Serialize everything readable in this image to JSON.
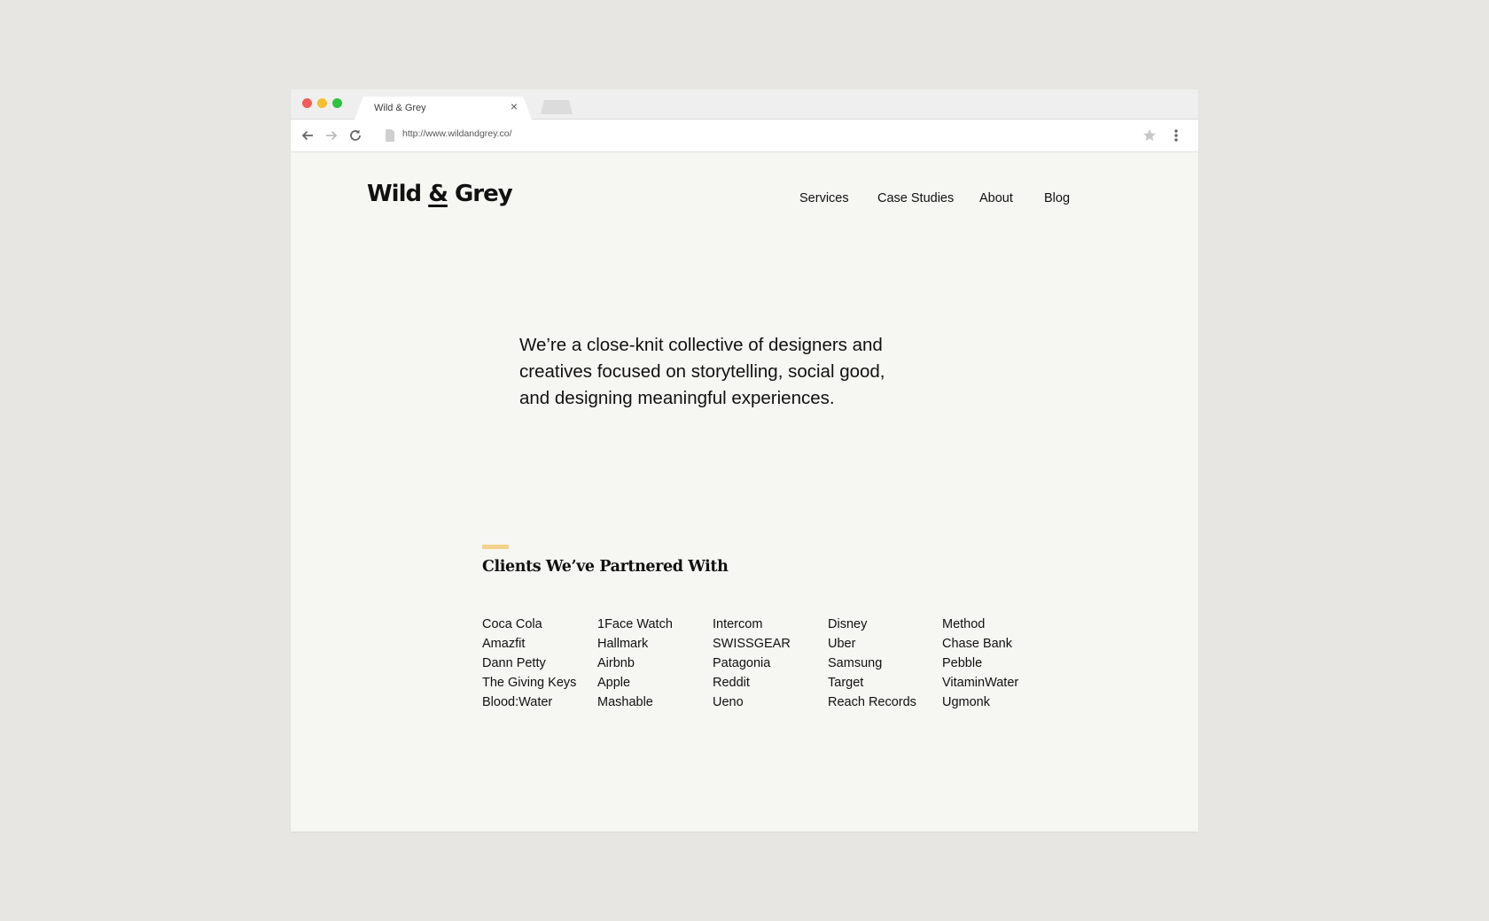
{
  "browser": {
    "tab_title": "Wild & Grey",
    "tab_close": "×",
    "url": "http://www.wildandgrey.co/",
    "icons": [
      "back-arrow-icon",
      "forward-arrow-icon",
      "reload-icon",
      "document-icon",
      "star-icon",
      "more-vert-icon"
    ]
  },
  "site": {
    "logo": {
      "left": "Wild",
      "amp": "&",
      "right": "Grey"
    },
    "nav": [
      "Services",
      "Case Studies",
      "About",
      "Blog"
    ],
    "intro": "We’re a close-knit collective of designers and creatives focused on storytelling, social good, and designing meaningful experiences.",
    "clients_title": "Clients We’ve Partnered With",
    "clients_columns": [
      [
        "Coca Cola",
        "Amazfit",
        "Dann Petty",
        "The Giving Keys",
        "Blood:Water"
      ],
      [
        "1Face Watch",
        "Hallmark",
        "Airbnb",
        "Apple",
        "Mashable"
      ],
      [
        "Intercom",
        "SWISSGEAR",
        "Patagonia",
        "Reddit",
        "Ueno"
      ],
      [
        "Disney",
        "Uber",
        "Samsung",
        "Target",
        "Reach Records"
      ],
      [
        "Method",
        "Chase Bank",
        "Pebble",
        "VitaminWater",
        "Ugmonk"
      ]
    ]
  },
  "colors": {
    "page_background": "#e7e6e2",
    "site_background": "#f6f6f2",
    "accent": "#f3d28b",
    "traffic_red": "#f25b57",
    "traffic_yellow": "#f5be2e",
    "traffic_green": "#2ec241"
  }
}
